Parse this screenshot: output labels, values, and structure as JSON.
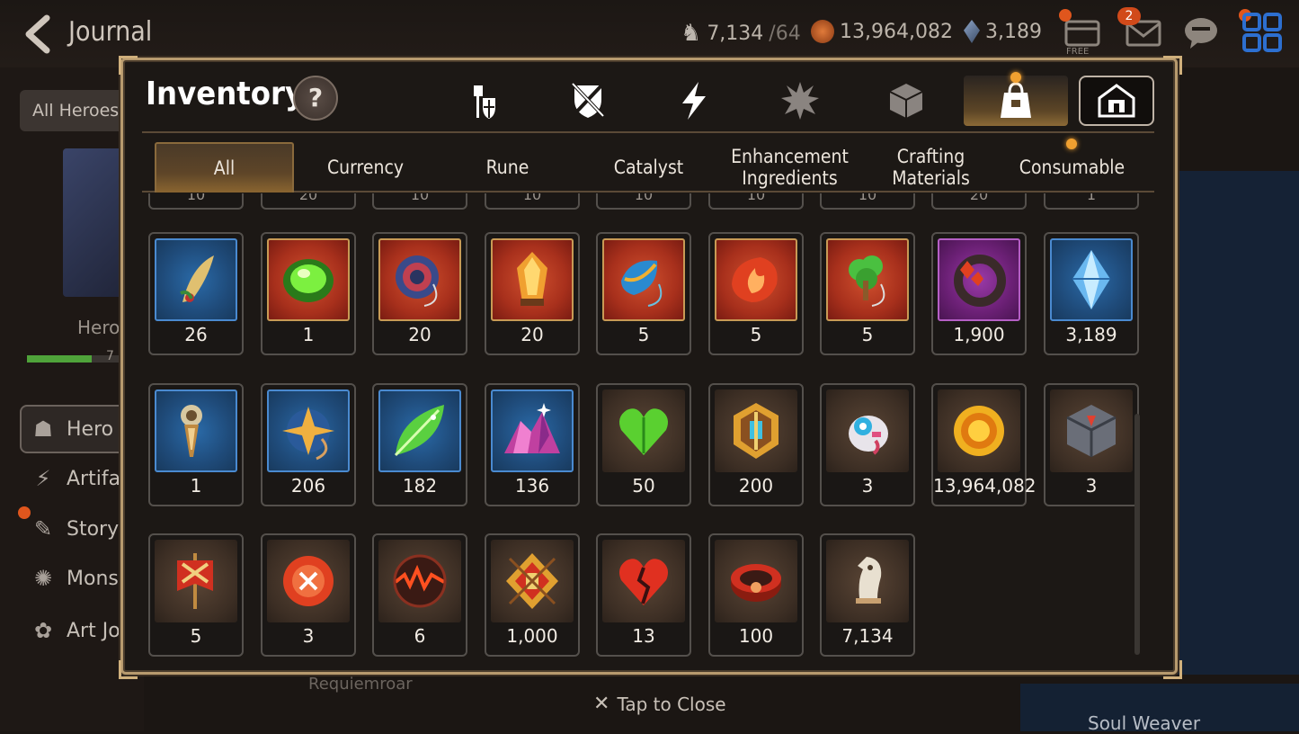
{
  "header": {
    "title": "Journal",
    "resources": [
      {
        "name": "skystone-knight",
        "value": "7,134",
        "denom": "/64",
        "icon": "knight-chess-icon"
      },
      {
        "name": "gold",
        "value": "13,964,082",
        "icon": "gold-coin-icon"
      },
      {
        "name": "crystal",
        "value": "3,189",
        "icon": "crystal-icon"
      }
    ],
    "mail_count": "2",
    "free_label": "FREE"
  },
  "sidebar": {
    "all_heroes_label": "All Heroes",
    "hero_label": "Hero",
    "hero_progress_text": "7",
    "hero_progress": 0.55,
    "items": [
      {
        "label": "Hero J",
        "icon": "demon-face-icon"
      },
      {
        "label": "Artifa",
        "icon": "lightning-icon"
      },
      {
        "label": "Story",
        "icon": "scroll-icon"
      },
      {
        "label": "Monst",
        "icon": "beast-icon"
      },
      {
        "label": "Art Jo",
        "icon": "palette-icon"
      }
    ]
  },
  "background": {
    "requiem_label": "Requiemroar",
    "soul_weaver_label": "Soul Weaver"
  },
  "inventory": {
    "title": "Inventory",
    "help_label": "?",
    "category_tabs": [
      {
        "name": "equipment",
        "icon": "knight-shield-icon"
      },
      {
        "name": "artifact",
        "icon": "crossed-sword-shield-icon"
      },
      {
        "name": "special",
        "icon": "lightning-icon"
      },
      {
        "name": "material",
        "icon": "splash-icon"
      },
      {
        "name": "misc",
        "icon": "cube-icon"
      },
      {
        "name": "items",
        "icon": "bag-icon",
        "active": true
      },
      {
        "name": "storage",
        "icon": "house-icon"
      }
    ],
    "filter_tabs": [
      {
        "label": "All",
        "active": true
      },
      {
        "label": "Currency"
      },
      {
        "label": "Rune"
      },
      {
        "label": "Catalyst"
      },
      {
        "label": "Enhancement\nIngredients"
      },
      {
        "label": "Crafting\nMaterials"
      },
      {
        "label": "Consumable"
      }
    ],
    "partial_row": [
      "10",
      "20",
      "10",
      "10",
      "10",
      "10",
      "10",
      "20",
      "1"
    ],
    "rows": [
      [
        {
          "qty": "26",
          "icon": "feather-charm-icon",
          "bg": "blue"
        },
        {
          "qty": "1",
          "icon": "green-orb-icon",
          "bg": "red"
        },
        {
          "qty": "20",
          "icon": "blue-swirl-rune-icon",
          "bg": "red"
        },
        {
          "qty": "20",
          "icon": "flame-crystal-icon",
          "bg": "red"
        },
        {
          "qty": "5",
          "icon": "blue-drop-rune-icon",
          "bg": "red"
        },
        {
          "qty": "5",
          "icon": "fire-rune-icon",
          "bg": "red"
        },
        {
          "qty": "5",
          "icon": "tree-rune-icon",
          "bg": "red"
        },
        {
          "qty": "1,900",
          "icon": "rune-bracelet-icon",
          "bg": "purple"
        },
        {
          "qty": "3,189",
          "icon": "blue-crystal-icon",
          "bg": "blue"
        }
      ],
      [
        {
          "qty": "1",
          "icon": "compass-dagger-icon",
          "bg": "blue"
        },
        {
          "qty": "206",
          "icon": "star-amulet-icon",
          "bg": "blue"
        },
        {
          "qty": "182",
          "icon": "green-leaf-icon",
          "bg": "blue"
        },
        {
          "qty": "136",
          "icon": "pink-crystal-icon",
          "bg": "blue"
        },
        {
          "qty": "50",
          "icon": "green-heart-icon",
          "bg": "brown"
        },
        {
          "qty": "200",
          "icon": "golden-emblem-icon",
          "bg": "brown"
        },
        {
          "qty": "3",
          "icon": "robot-pet-icon",
          "bg": "brown"
        },
        {
          "qty": "13,964,082",
          "icon": "gold-coin-icon",
          "bg": "brown"
        },
        {
          "qty": "3",
          "icon": "stone-cube-icon",
          "bg": "brown"
        }
      ],
      [
        {
          "qty": "5",
          "icon": "red-banner-icon",
          "bg": "brown"
        },
        {
          "qty": "3",
          "icon": "red-seal-badge-icon",
          "bg": "brown"
        },
        {
          "qty": "6",
          "icon": "lava-orb-icon",
          "bg": "brown"
        },
        {
          "qty": "1,000",
          "icon": "fist-emblem-icon",
          "bg": "brown"
        },
        {
          "qty": "13",
          "icon": "broken-heart-leaf-icon",
          "bg": "brown"
        },
        {
          "qty": "100",
          "icon": "red-bracelet-icon",
          "bg": "brown"
        },
        {
          "qty": "7,134",
          "icon": "knight-chess-icon",
          "bg": "brown"
        }
      ]
    ],
    "close_label": "Tap to Close"
  }
}
